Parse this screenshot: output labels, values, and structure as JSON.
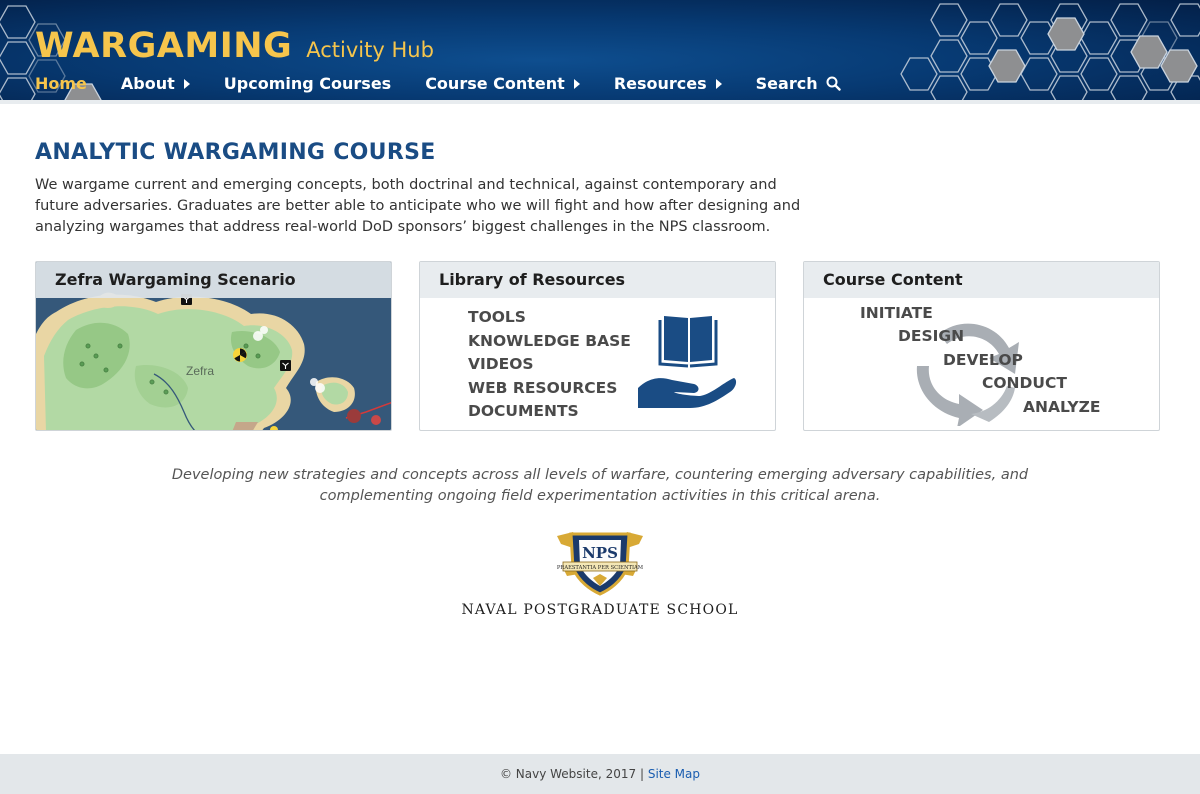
{
  "header": {
    "brand_main": "WARGAMING",
    "brand_sub": "Activity Hub",
    "nav": [
      {
        "label": "Home",
        "active": true
      },
      {
        "label": "About",
        "has_dropdown": true
      },
      {
        "label": "Upcoming Courses"
      },
      {
        "label": "Course Content",
        "has_dropdown": true
      },
      {
        "label": "Resources",
        "has_dropdown": true
      },
      {
        "label": "Search",
        "icon": "search-icon"
      }
    ]
  },
  "main": {
    "title": "ANALYTIC WARGAMING COURSE",
    "intro": "We wargame current and emerging concepts, both doctrinal and technical, against contemporary and future adversaries. Graduates are better able to anticipate who we will fight and how after designing and analyzing wargames that address real-world DoD sponsors’ biggest challenges in the NPS classroom."
  },
  "cards": {
    "scenario": {
      "title": "Zefra Wargaming Scenario",
      "map_label": "Zefra"
    },
    "library": {
      "title": "Library of Resources",
      "items": [
        "TOOLS",
        "KNOWLEDGE BASE",
        "VIDEOS",
        "WEB RESOURCES",
        "DOCUMENTS"
      ]
    },
    "course": {
      "title": "Course Content",
      "steps": [
        "INITIATE",
        "DESIGN",
        "DEVELOP",
        "CONDUCT",
        "ANALYZE"
      ]
    }
  },
  "tagline": "Developing new strategies and concepts across all levels of warfare, countering emerging adversary capabilities, and complementing ongoing field experimentation activities in this critical arena.",
  "seal": {
    "initials": "NPS",
    "motto": "PRAESTANTIA PER SCIENTIAM"
  },
  "school_name": "NAVAL POSTGRADUATE SCHOOL",
  "footer": {
    "copyright": "© Navy Website, 2017 |",
    "sitemap": "Site Map"
  },
  "colors": {
    "brand_gold": "#f6c54c",
    "header_blue": "#073a73",
    "title_blue": "#1a4c84",
    "icon_blue": "#1a4c84",
    "link_blue": "#1a5db0"
  }
}
